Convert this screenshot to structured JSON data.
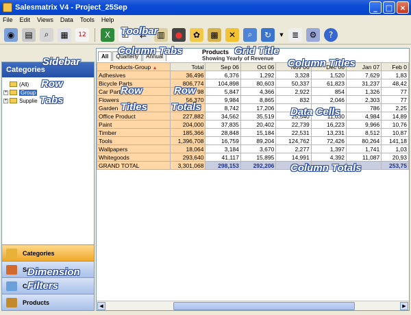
{
  "window": {
    "title": "Salesmatrix V4 - Project_25Sep"
  },
  "menu": [
    "File",
    "Edit",
    "Views",
    "Data",
    "Tools",
    "Help"
  ],
  "overlays": {
    "toolbar": "Toolbar",
    "sidebar": "Sidebar",
    "column_tabs": "Column Tabs",
    "grid_title": "Grid Title",
    "column_titles": "Column Titles",
    "row_tabs_1": "Row",
    "row_tabs_2": "Tabs",
    "row_titles_1": "Row",
    "row_titles_2": "Titles",
    "row_totals_1": "Row",
    "row_totals_2": "Totals",
    "data_cells": "Data Cells",
    "column_totals": "Column Totals",
    "dimension_filters_1": "Dimension",
    "dimension_filters_2": "Filters"
  },
  "sidebar": {
    "header": "Categories",
    "tree": [
      {
        "label": "(All)",
        "expander": ""
      },
      {
        "label": "Group",
        "expander": "+",
        "selected": true
      },
      {
        "label": "Supplie",
        "expander": "+"
      }
    ],
    "dimensions": [
      {
        "label": "Categories",
        "active": true,
        "icon_color": "#e8b23a"
      },
      {
        "label": "Sa",
        "active": false,
        "icon_color": "#d06a2f"
      },
      {
        "label": "Cu",
        "active": false,
        "icon_color": "#6aa0d8"
      },
      {
        "label": "Products",
        "active": false,
        "icon_color": "#c28a2a"
      }
    ]
  },
  "grid": {
    "tabs": [
      "All",
      "Quarterly",
      "Annual"
    ],
    "title": "Products",
    "subtitle": "Showing Yearly of Revenue",
    "row_header": "Products-Group",
    "sort_icon": "▲",
    "columns": [
      "Total",
      "Sep 06",
      "Oct 06",
      "Nov 06",
      "Dec 06",
      "Jan 07",
      "Feb 0"
    ],
    "rows": [
      {
        "name": "Adhesives",
        "values": [
          "36,496",
          "6,376",
          "1,292",
          "3,328",
          "1,520",
          "7,629",
          "1,83"
        ]
      },
      {
        "name": "Bicycle Parts",
        "values": [
          "806,774",
          "104,898",
          "80,603",
          "50,337",
          "61,823",
          "31,237",
          "48,42"
        ]
      },
      {
        "name": "Car Parts",
        "values": [
          "98",
          "5,847",
          "4,366",
          "2,922",
          "854",
          "1,326",
          "77"
        ]
      },
      {
        "name": "Flowers",
        "values": [
          "56,370",
          "9,984",
          "8,865",
          "832",
          "2,046",
          "2,303",
          "77"
        ]
      },
      {
        "name": "Garden",
        "values": [
          "",
          "8,742",
          "17,206",
          "",
          "",
          "786",
          "2,25"
        ]
      },
      {
        "name": "Office Product",
        "values": [
          "227,882",
          "34,562",
          "35,519",
          "25,540",
          "11,030",
          "4,984",
          "14,89"
        ]
      },
      {
        "name": "Paint",
        "values": [
          "204,000",
          "37,835",
          "20,402",
          "22,739",
          "16,223",
          "9,966",
          "10,76"
        ]
      },
      {
        "name": "Timber",
        "values": [
          "185,366",
          "28,848",
          "15,184",
          "22,531",
          "13,231",
          "8,512",
          "10,87"
        ]
      },
      {
        "name": "Tools",
        "values": [
          "1,396,708",
          "16,759",
          "89,204",
          "124,762",
          "72,426",
          "80,264",
          "141,18"
        ]
      },
      {
        "name": "Wallpapers",
        "values": [
          "18,064",
          "3,184",
          "3,670",
          "2,277",
          "1,397",
          "1,741",
          "1,03"
        ]
      },
      {
        "name": "Whitegoods",
        "values": [
          "293,640",
          "41,117",
          "15,895",
          "14,991",
          "4,392",
          "11,087",
          "20,93"
        ]
      }
    ],
    "grand_total": {
      "name": "GRAND TOTAL",
      "values": [
        "3,301,068",
        "298,153",
        "292,206",
        "2",
        "",
        "",
        "253,75"
      ]
    }
  }
}
